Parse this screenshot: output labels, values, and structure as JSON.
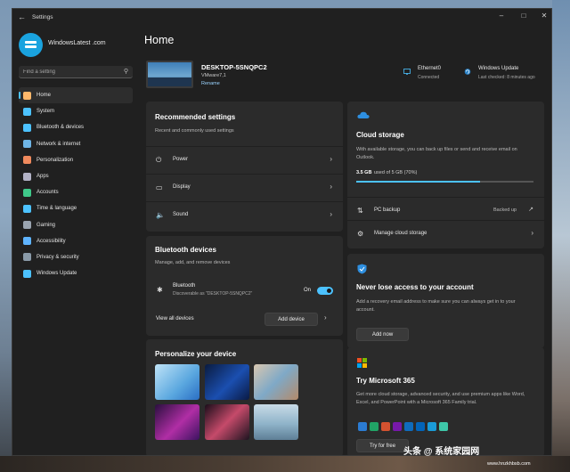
{
  "window": {
    "title": "Settings",
    "back_glyph": "←",
    "controls": {
      "minimize": "–",
      "maximize": "□",
      "close": "✕"
    }
  },
  "profile": {
    "name": "WindowsLatest .com"
  },
  "search": {
    "placeholder": "Find a setting",
    "icon": "search-icon"
  },
  "nav": {
    "items": [
      {
        "label": "Home",
        "icon": "home-icon",
        "color": "#ffb86b",
        "active": true
      },
      {
        "label": "System",
        "icon": "monitor-icon",
        "color": "#4cc2ff"
      },
      {
        "label": "Bluetooth & devices",
        "icon": "bluetooth-icon",
        "color": "#4cc2ff"
      },
      {
        "label": "Network & internet",
        "icon": "wifi-icon",
        "color": "#6fb5e6"
      },
      {
        "label": "Personalization",
        "icon": "brush-icon",
        "color": "#f08a5d"
      },
      {
        "label": "Apps",
        "icon": "apps-icon",
        "color": "#b3b3c7"
      },
      {
        "label": "Accounts",
        "icon": "person-icon",
        "color": "#3fc98a"
      },
      {
        "label": "Time & language",
        "icon": "globe-clock-icon",
        "color": "#4cc2ff"
      },
      {
        "label": "Gaming",
        "icon": "gamepad-icon",
        "color": "#9aa4b0"
      },
      {
        "label": "Accessibility",
        "icon": "accessibility-icon",
        "color": "#5fb4ff"
      },
      {
        "label": "Privacy & security",
        "icon": "shield-icon",
        "color": "#8a9aa8"
      },
      {
        "label": "Windows Update",
        "icon": "update-icon",
        "color": "#4cc2ff"
      }
    ]
  },
  "main": {
    "title": "Home",
    "device": {
      "name": "DESKTOP-5SNQPC2",
      "model": "VMware7,1",
      "rename": "Rename"
    },
    "status": [
      {
        "title": "Ethernet0",
        "sub": "Connected",
        "icon": "ethernet-icon"
      },
      {
        "title": "Windows Update",
        "sub": "Last checked: 8 minutes ago",
        "icon": "update-icon"
      }
    ],
    "recommended": {
      "title": "Recommended settings",
      "sub": "Recent and commonly used settings",
      "rows": [
        {
          "label": "Power",
          "icon": "power-icon"
        },
        {
          "label": "Display",
          "icon": "display-icon"
        },
        {
          "label": "Sound",
          "icon": "speaker-icon"
        }
      ]
    },
    "bluetooth": {
      "title": "Bluetooth devices",
      "sub": "Manage, add, and remove devices",
      "item_title": "Bluetooth",
      "item_sub": "Discoverable as \"DESKTOP-5SNQPC2\"",
      "toggle_label": "On",
      "toggle_on": true,
      "view_all": "View all devices",
      "add_device": "Add device"
    },
    "personalize": {
      "title": "Personalize your device"
    },
    "cloud": {
      "title": "Cloud storage",
      "desc": "With available storage, you can back up files or send and receive email on Outlook.",
      "used": "3.5 GB",
      "usage_text": "used of 5 GB (70%)",
      "fill_fraction": 0.7,
      "pc_backup": "PC backup",
      "backed_up": "Backed up",
      "manage": "Manage cloud storage"
    },
    "security": {
      "title": "Never lose access to your account",
      "desc": "Add a recovery email address to make sure you can always get in to your account.",
      "button": "Add now"
    },
    "m365": {
      "title": "Try Microsoft 365",
      "desc": "Get more cloud storage, advanced security, and use premium apps like Word, Excel, and PowerPoint with a Microsoft 365 Family trial.",
      "button": "Try for free",
      "app_colors": [
        "#2b7cd3",
        "#21a366",
        "#d35230",
        "#7719aa",
        "#0f6cbd",
        "#0364b8",
        "#1a9bd7",
        "#3ec7a8"
      ]
    }
  },
  "watermark": {
    "text": "头条 @ 系统家园网",
    "url": "www.hnzkhbsb.com"
  }
}
